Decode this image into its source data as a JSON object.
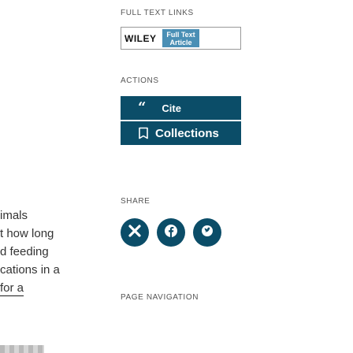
{
  "article_text": {
    "lines": [
      "imals",
      "t how long",
      "d feeding",
      "cations in a",
      "for a"
    ]
  },
  "sidebar": {
    "full_text_links": {
      "heading": "FULL TEXT LINKS",
      "publisher": "WILEY",
      "badge_line1": "Full Text",
      "badge_line2": "Article"
    },
    "actions": {
      "heading": "ACTIONS",
      "cite_label": "Cite",
      "collections_label": "Collections"
    },
    "share": {
      "heading": "SHARE",
      "buttons": [
        "email-icon",
        "facebook-icon",
        "twitter-icon"
      ]
    },
    "page_navigation": {
      "heading": "PAGE NAVIGATION"
    }
  },
  "colors": {
    "button_bg": "#0b4d68",
    "badge_bg": "#4a8fb5"
  }
}
